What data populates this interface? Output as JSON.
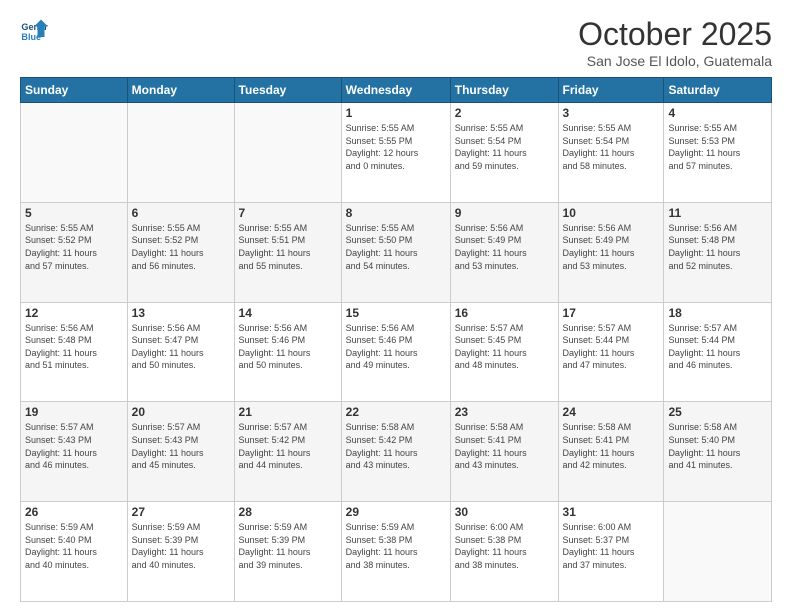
{
  "header": {
    "logo_line1": "General",
    "logo_line2": "Blue",
    "title": "October 2025",
    "subtitle": "San Jose El Idolo, Guatemala"
  },
  "days_of_week": [
    "Sunday",
    "Monday",
    "Tuesday",
    "Wednesday",
    "Thursday",
    "Friday",
    "Saturday"
  ],
  "weeks": [
    [
      {
        "day": "",
        "info": ""
      },
      {
        "day": "",
        "info": ""
      },
      {
        "day": "",
        "info": ""
      },
      {
        "day": "1",
        "info": "Sunrise: 5:55 AM\nSunset: 5:55 PM\nDaylight: 12 hours\nand 0 minutes."
      },
      {
        "day": "2",
        "info": "Sunrise: 5:55 AM\nSunset: 5:54 PM\nDaylight: 11 hours\nand 59 minutes."
      },
      {
        "day": "3",
        "info": "Sunrise: 5:55 AM\nSunset: 5:54 PM\nDaylight: 11 hours\nand 58 minutes."
      },
      {
        "day": "4",
        "info": "Sunrise: 5:55 AM\nSunset: 5:53 PM\nDaylight: 11 hours\nand 57 minutes."
      }
    ],
    [
      {
        "day": "5",
        "info": "Sunrise: 5:55 AM\nSunset: 5:52 PM\nDaylight: 11 hours\nand 57 minutes."
      },
      {
        "day": "6",
        "info": "Sunrise: 5:55 AM\nSunset: 5:52 PM\nDaylight: 11 hours\nand 56 minutes."
      },
      {
        "day": "7",
        "info": "Sunrise: 5:55 AM\nSunset: 5:51 PM\nDaylight: 11 hours\nand 55 minutes."
      },
      {
        "day": "8",
        "info": "Sunrise: 5:55 AM\nSunset: 5:50 PM\nDaylight: 11 hours\nand 54 minutes."
      },
      {
        "day": "9",
        "info": "Sunrise: 5:56 AM\nSunset: 5:49 PM\nDaylight: 11 hours\nand 53 minutes."
      },
      {
        "day": "10",
        "info": "Sunrise: 5:56 AM\nSunset: 5:49 PM\nDaylight: 11 hours\nand 53 minutes."
      },
      {
        "day": "11",
        "info": "Sunrise: 5:56 AM\nSunset: 5:48 PM\nDaylight: 11 hours\nand 52 minutes."
      }
    ],
    [
      {
        "day": "12",
        "info": "Sunrise: 5:56 AM\nSunset: 5:48 PM\nDaylight: 11 hours\nand 51 minutes."
      },
      {
        "day": "13",
        "info": "Sunrise: 5:56 AM\nSunset: 5:47 PM\nDaylight: 11 hours\nand 50 minutes."
      },
      {
        "day": "14",
        "info": "Sunrise: 5:56 AM\nSunset: 5:46 PM\nDaylight: 11 hours\nand 50 minutes."
      },
      {
        "day": "15",
        "info": "Sunrise: 5:56 AM\nSunset: 5:46 PM\nDaylight: 11 hours\nand 49 minutes."
      },
      {
        "day": "16",
        "info": "Sunrise: 5:57 AM\nSunset: 5:45 PM\nDaylight: 11 hours\nand 48 minutes."
      },
      {
        "day": "17",
        "info": "Sunrise: 5:57 AM\nSunset: 5:44 PM\nDaylight: 11 hours\nand 47 minutes."
      },
      {
        "day": "18",
        "info": "Sunrise: 5:57 AM\nSunset: 5:44 PM\nDaylight: 11 hours\nand 46 minutes."
      }
    ],
    [
      {
        "day": "19",
        "info": "Sunrise: 5:57 AM\nSunset: 5:43 PM\nDaylight: 11 hours\nand 46 minutes."
      },
      {
        "day": "20",
        "info": "Sunrise: 5:57 AM\nSunset: 5:43 PM\nDaylight: 11 hours\nand 45 minutes."
      },
      {
        "day": "21",
        "info": "Sunrise: 5:57 AM\nSunset: 5:42 PM\nDaylight: 11 hours\nand 44 minutes."
      },
      {
        "day": "22",
        "info": "Sunrise: 5:58 AM\nSunset: 5:42 PM\nDaylight: 11 hours\nand 43 minutes."
      },
      {
        "day": "23",
        "info": "Sunrise: 5:58 AM\nSunset: 5:41 PM\nDaylight: 11 hours\nand 43 minutes."
      },
      {
        "day": "24",
        "info": "Sunrise: 5:58 AM\nSunset: 5:41 PM\nDaylight: 11 hours\nand 42 minutes."
      },
      {
        "day": "25",
        "info": "Sunrise: 5:58 AM\nSunset: 5:40 PM\nDaylight: 11 hours\nand 41 minutes."
      }
    ],
    [
      {
        "day": "26",
        "info": "Sunrise: 5:59 AM\nSunset: 5:40 PM\nDaylight: 11 hours\nand 40 minutes."
      },
      {
        "day": "27",
        "info": "Sunrise: 5:59 AM\nSunset: 5:39 PM\nDaylight: 11 hours\nand 40 minutes."
      },
      {
        "day": "28",
        "info": "Sunrise: 5:59 AM\nSunset: 5:39 PM\nDaylight: 11 hours\nand 39 minutes."
      },
      {
        "day": "29",
        "info": "Sunrise: 5:59 AM\nSunset: 5:38 PM\nDaylight: 11 hours\nand 38 minutes."
      },
      {
        "day": "30",
        "info": "Sunrise: 6:00 AM\nSunset: 5:38 PM\nDaylight: 11 hours\nand 38 minutes."
      },
      {
        "day": "31",
        "info": "Sunrise: 6:00 AM\nSunset: 5:37 PM\nDaylight: 11 hours\nand 37 minutes."
      },
      {
        "day": "",
        "info": ""
      }
    ]
  ]
}
